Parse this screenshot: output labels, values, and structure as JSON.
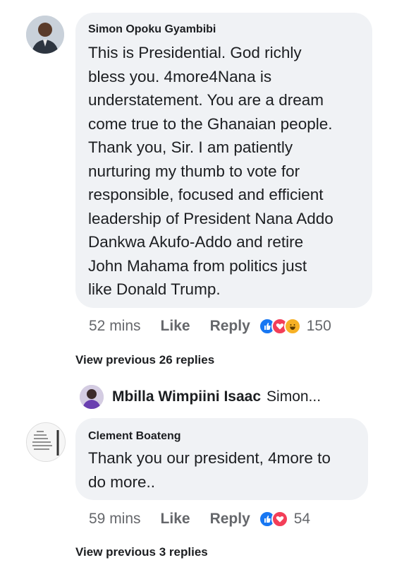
{
  "comments": [
    {
      "author": "Simon Opoku Gyambibi",
      "lines": [
        "This is Presidential. God richly",
        "bless you. 4more4Nana is",
        "understatement. You are a dream",
        "come true to the Ghanaian people.",
        "Thank you, Sir. I am patiently",
        "nurturing my thumb to vote for",
        "responsible, focused and efficient",
        "leadership of President Nana Addo",
        "Dankwa Akufo-Addo and retire",
        "John Mahama from politics just",
        "like Donald Trump."
      ],
      "time": "52 mins",
      "like_label": "Like",
      "reply_label": "Reply",
      "reaction_count": "150",
      "reactions": [
        "like",
        "love",
        "haha"
      ]
    },
    {
      "author": "Clement Boateng",
      "lines": [
        "Thank you our president, 4more to",
        "do more.."
      ],
      "time": "59 mins",
      "like_label": "Like",
      "reply_label": "Reply",
      "reaction_count": "54",
      "reactions": [
        "like",
        "love"
      ]
    }
  ],
  "view_previous_1": "View previous 26 replies",
  "reply_preview": {
    "name": "Mbilla Wimpiini Isaac",
    "snippet": "Simon..."
  },
  "view_previous_2": "View previous 3 replies",
  "colors": {
    "bubble": "#f0f2f5",
    "muted": "#65676b",
    "like": "#1877f2",
    "love": "#f33e58",
    "haha": "#f7b125"
  }
}
